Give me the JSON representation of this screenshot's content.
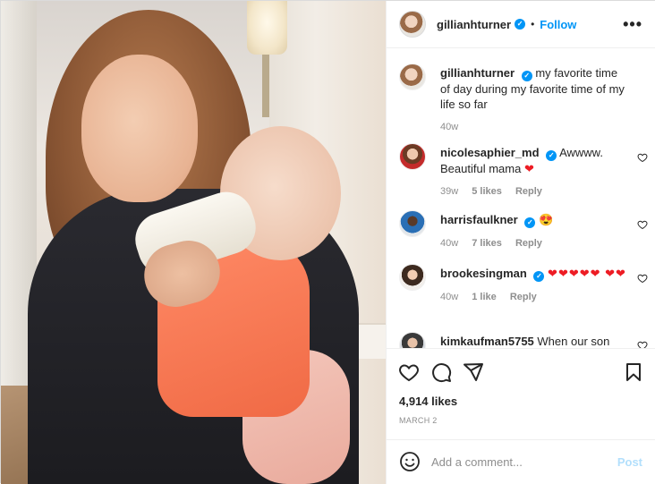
{
  "header": {
    "username": "gillianhturner",
    "separator": "•",
    "follow_label": "Follow",
    "more_label": "•••"
  },
  "caption": {
    "username": "gillianhturner",
    "text": "my favorite time of day during my favorite time of my life so far",
    "age": "40w"
  },
  "comments": [
    {
      "username": "nicolesaphier_md",
      "text": "Awwww. Beautiful mama",
      "emoji": "❤",
      "age": "39w",
      "likes": "5 likes",
      "reply": "Reply"
    },
    {
      "username": "harrisfaulkner",
      "text": "",
      "emoji": "😍",
      "age": "40w",
      "likes": "7 likes",
      "reply": "Reply"
    },
    {
      "username": "brookesingman",
      "text": "",
      "emoji": "❤❤❤❤❤ ❤❤",
      "age": "40w",
      "likes": "1 like",
      "reply": "Reply"
    },
    {
      "username": "kimkaufman5755",
      "text": "When our son"
    }
  ],
  "likes": "4,914 likes",
  "date": "MARCH 2",
  "add_comment": {
    "placeholder": "Add a comment...",
    "post_label": "Post"
  },
  "icons": [
    "heart-icon",
    "comment-icon",
    "share-icon",
    "bookmark-icon",
    "emoji-icon",
    "more-icon",
    "verified-icon"
  ],
  "colors": {
    "accent": "#0095f6",
    "post_disabled": "#b2dffc",
    "heart_red": "#ed1c24",
    "muted": "#8e8e8e"
  }
}
